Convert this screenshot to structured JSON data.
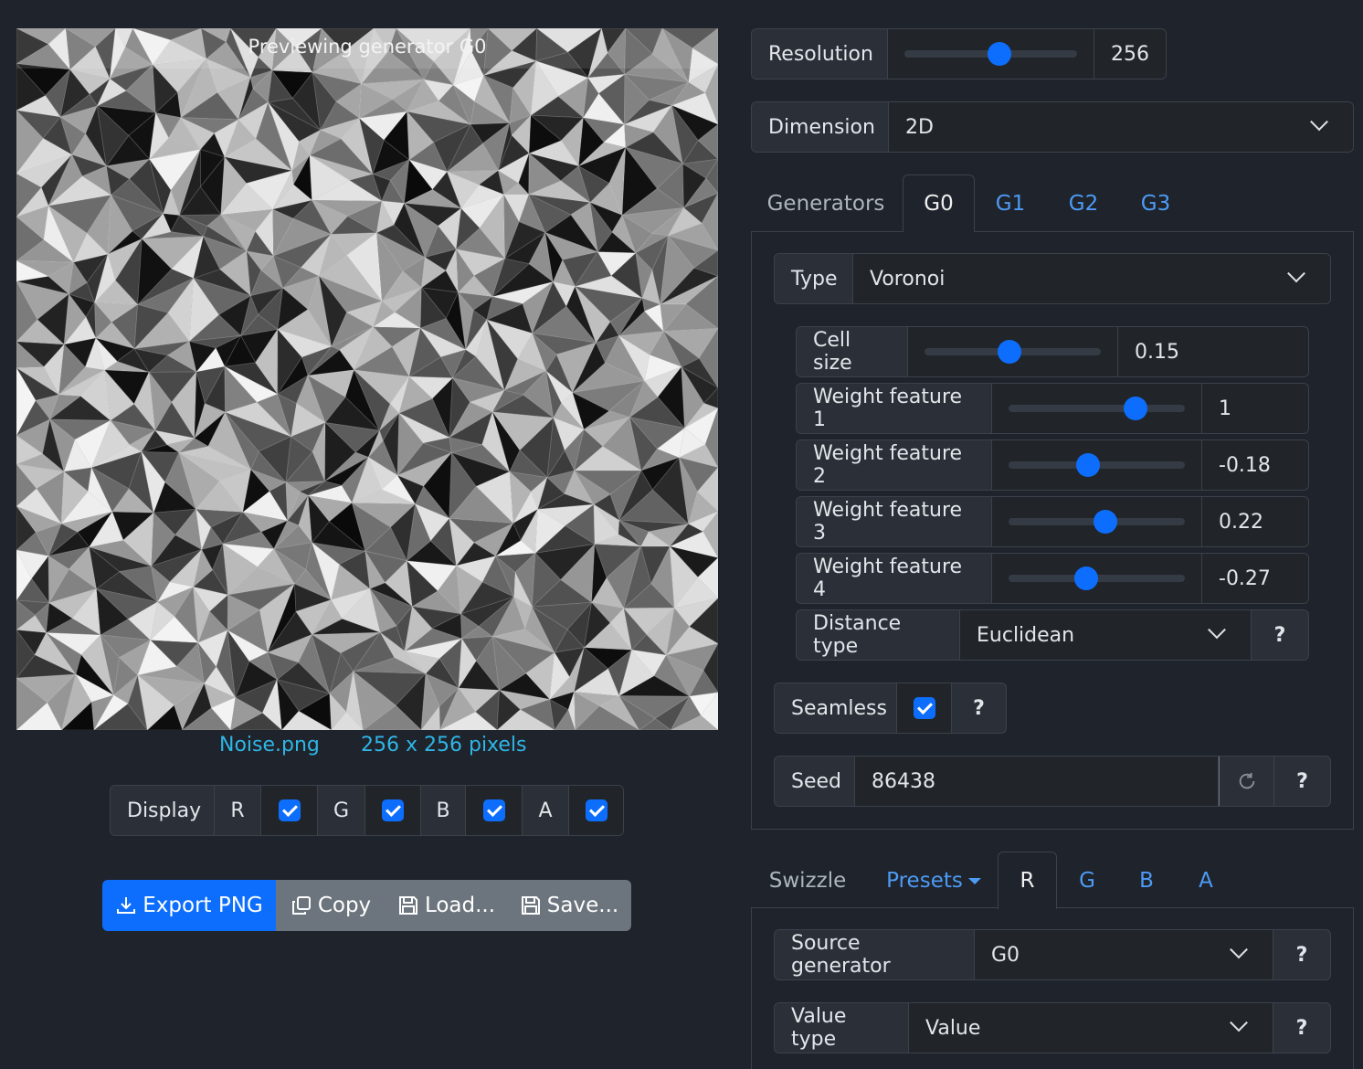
{
  "preview": {
    "banner": "Previewing generator G0",
    "filename": "Noise.png",
    "dimensions": "256 x 256 pixels"
  },
  "display": {
    "label": "Display",
    "channels": [
      {
        "name": "R",
        "checked": true
      },
      {
        "name": "G",
        "checked": true
      },
      {
        "name": "B",
        "checked": true
      },
      {
        "name": "A",
        "checked": true
      }
    ]
  },
  "actions": {
    "export": "Export PNG",
    "copy": "Copy",
    "load": "Load...",
    "save": "Save..."
  },
  "resolution": {
    "label": "Resolution",
    "value": "256",
    "slider_fraction": 0.55
  },
  "dimension": {
    "label": "Dimension",
    "value": "2D"
  },
  "generator_tabs": {
    "title": "Generators",
    "tabs": [
      "G0",
      "G1",
      "G2",
      "G3"
    ],
    "active": "G0"
  },
  "generator": {
    "type_label": "Type",
    "type_value": "Voronoi",
    "params": [
      {
        "label": "Cell size",
        "value": "0.15",
        "slider_fraction": 0.48
      },
      {
        "label": "Weight feature 1",
        "value": "1",
        "slider_fraction": 0.72
      },
      {
        "label": "Weight feature 2",
        "value": "-0.18",
        "slider_fraction": 0.45
      },
      {
        "label": "Weight feature 3",
        "value": "0.22",
        "slider_fraction": 0.55
      },
      {
        "label": "Weight feature 4",
        "value": "-0.27",
        "slider_fraction": 0.44
      }
    ],
    "distance_label": "Distance type",
    "distance_value": "Euclidean",
    "seamless_label": "Seamless",
    "seamless_checked": true,
    "seed_label": "Seed",
    "seed_value": "86438",
    "help": "?"
  },
  "swizzle_tabs": {
    "title": "Swizzle",
    "presets": "Presets",
    "tabs": [
      "R",
      "G",
      "B",
      "A"
    ],
    "active": "R"
  },
  "swizzle": {
    "source_label": "Source generator",
    "source_value": "G0",
    "value_type_label": "Value type",
    "value_type_value": "Value",
    "help": "?"
  },
  "colors": {
    "accent": "#0d6efd",
    "background": "#1f232b",
    "link": "#4d9bf5",
    "filename": "#2fb6e6"
  }
}
